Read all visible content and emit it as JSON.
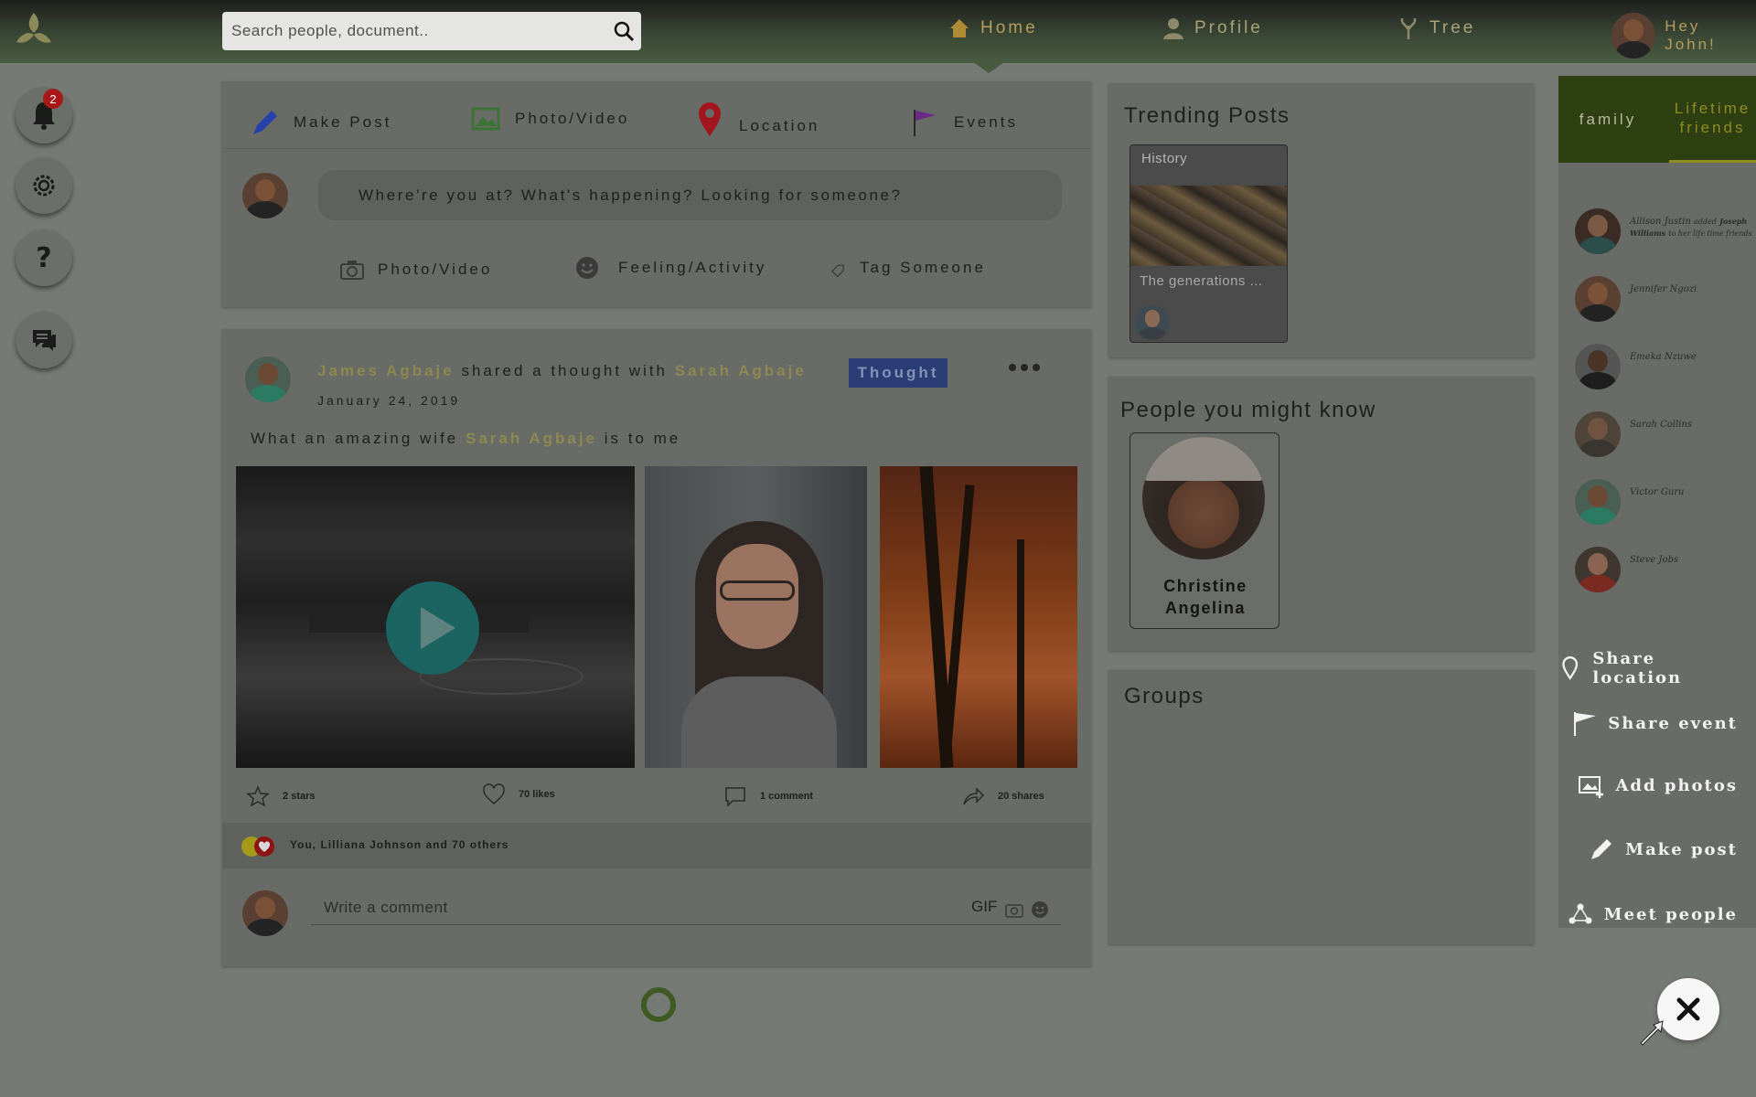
{
  "header": {
    "search_placeholder": "Search people, document..",
    "nav": [
      {
        "label": "Home",
        "icon": "home-icon"
      },
      {
        "label": "Profile",
        "icon": "profile-icon"
      },
      {
        "label": "Tree",
        "icon": "tree-icon"
      }
    ],
    "greeting": "Hey John!"
  },
  "left_rail": {
    "notification_count": "2",
    "buttons": [
      "bell-icon",
      "settings-icon",
      "help-icon",
      "chat-icon"
    ]
  },
  "composer": {
    "tabs": [
      "Make Post",
      "Photo/Video",
      "Location",
      "Events"
    ],
    "prompt": "Where're you at? What's happening? Looking for someone?",
    "actions": [
      "Photo/Video",
      "Feeling/Activity",
      "Tag Someone"
    ]
  },
  "post": {
    "author": "James Agbaje",
    "verb": "shared a thought with",
    "recipient": "Sarah Agbaje",
    "tag": "Thought",
    "date": "January 24, 2019",
    "text_before": "What an amazing wife",
    "text_mention": "Sarah Agbaje",
    "text_after": "is to me",
    "stats": {
      "stars": "2 stars",
      "likes": "70 likes",
      "comments": "1 comment",
      "shares": "20 shares"
    },
    "likers": "You, Lilliana Johnson and 70 others",
    "comment_placeholder": "Write a comment",
    "gif_label": "GIF"
  },
  "trending": {
    "title": "Trending Posts",
    "card": {
      "category": "History",
      "caption": "The generations ..."
    }
  },
  "people": {
    "title": "People you might know",
    "person": {
      "first": "Christine",
      "last": "Angelina"
    }
  },
  "groups": {
    "title": "Groups"
  },
  "right_sidebar": {
    "tabs": [
      "family",
      "Lifetime friends"
    ],
    "activity": [
      {
        "name": "Allison Justin",
        "verb": "added",
        "target": "Joseph Williams",
        "rest": "to her life time friends"
      },
      {
        "name": "Jennifer Ngozi"
      },
      {
        "name": "Emeka Nzuwe"
      },
      {
        "name": "Sarah Collins"
      },
      {
        "name": "Victor Guru"
      },
      {
        "name": "Steve Jobs"
      }
    ],
    "actions": [
      "Share location",
      "Share event",
      "Add photos",
      "Make post",
      "Meet people"
    ]
  },
  "colors": {
    "accent_gold": "#8d8950",
    "tag_blue": "#2a3d75",
    "tab_green": "#2e3f12",
    "badge_red": "#a81818"
  }
}
